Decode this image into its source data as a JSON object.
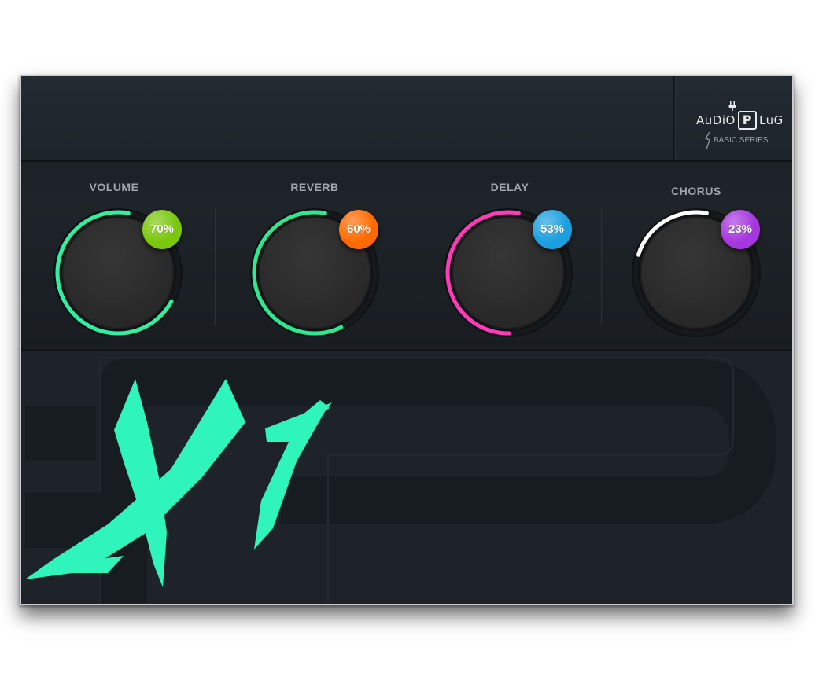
{
  "brand": {
    "name_part1": "AuDiO",
    "name_p": "P",
    "name_part2": "LuG",
    "series": "BASIC SERIES",
    "plug_icon": "plug-icon",
    "bolt_icon": "bolt-icon"
  },
  "product_logo": "X7",
  "knobs": [
    {
      "label": "VOLUME",
      "value": 0.7,
      "display": "70%",
      "ring_color": "#2ff0a0",
      "badge_color": "#7ac70c"
    },
    {
      "label": "REVERB",
      "value": 0.6,
      "display": "60%",
      "ring_color": "#2ee88f",
      "badge_color": "#ff6a00"
    },
    {
      "label": "DELAY",
      "value": 0.53,
      "display": "53%",
      "ring_color": "#ff3ab8",
      "badge_color": "#1a9fe0"
    },
    {
      "label": "CHORUS",
      "value": 0.23,
      "display": "23%",
      "ring_color": "#ffffff",
      "badge_color": "#a636e0"
    }
  ],
  "colors": {
    "panel": "#1c2228",
    "logo_accent": "#2ff5bd"
  }
}
